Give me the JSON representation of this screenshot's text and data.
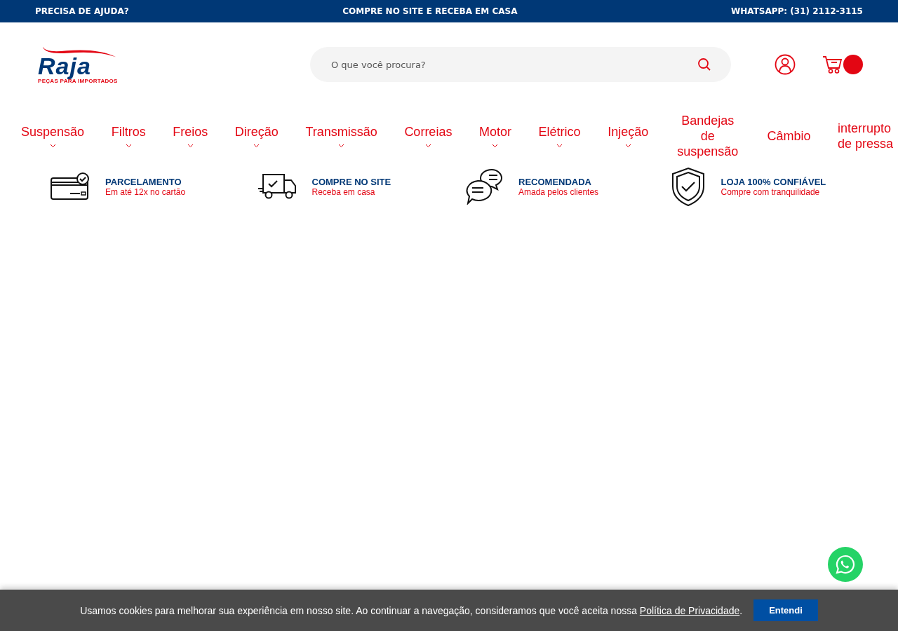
{
  "top_bar": {
    "left": "PRECISA DE AJUDA?",
    "center": "COMPRE NO SITE E RECEBA EM CASA",
    "right": "WHATSAPP: (31) 2112-3115"
  },
  "logo": {
    "name": "Raja",
    "tagline": "PEÇAS PARA IMPORTADOS"
  },
  "search": {
    "placeholder": "O que você procura?"
  },
  "nav": [
    {
      "label": "Suspensão",
      "has_dropdown": true
    },
    {
      "label": "Filtros",
      "has_dropdown": true
    },
    {
      "label": "Freios",
      "has_dropdown": true
    },
    {
      "label": "Direção",
      "has_dropdown": true
    },
    {
      "label": "Transmissão",
      "has_dropdown": true
    },
    {
      "label": "Correias",
      "has_dropdown": true
    },
    {
      "label": "Motor",
      "has_dropdown": true
    },
    {
      "label": "Elétrico",
      "has_dropdown": true
    },
    {
      "label": "Injeção",
      "has_dropdown": true
    },
    {
      "label": "Bandejas de suspensão",
      "has_dropdown": false
    },
    {
      "label": "Câmbio",
      "has_dropdown": false
    },
    {
      "label": "interrupto de pressa",
      "has_dropdown": false
    }
  ],
  "features": [
    {
      "kind": "card",
      "title": "PARCELAMENTO",
      "subtitle": "Em até 12x no cartão"
    },
    {
      "kind": "truck",
      "title": "COMPRE NO SITE",
      "subtitle": "Receba em casa"
    },
    {
      "kind": "chat",
      "title": "RECOMENDADA",
      "subtitle": "Amada pelos clientes"
    },
    {
      "kind": "shield",
      "title": "LOJA 100% CONFIÁVEL",
      "subtitle": "Compre com tranquilidade"
    }
  ],
  "cookie_bar": {
    "text": "Usamos cookies para melhorar sua experiência em nosso site. Ao continuar a navegação, consideramos que você aceita nossa",
    "link": "Política de Privacidade",
    "end": ".",
    "button": "Entendi"
  }
}
